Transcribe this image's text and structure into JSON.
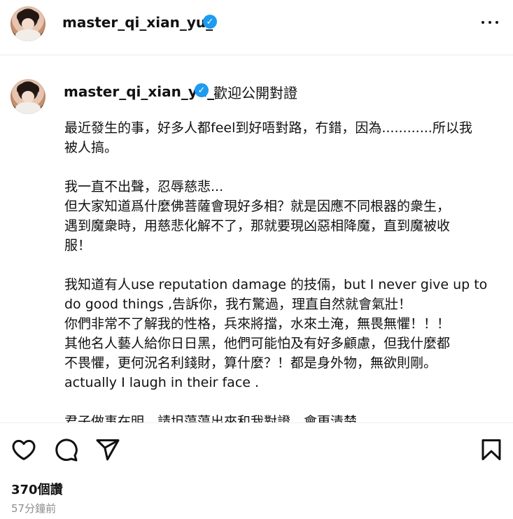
{
  "header": {
    "username": "master_qi_xian_yu_",
    "verified_symbol": "✓",
    "more_icon": "ellipsis"
  },
  "post": {
    "username": "master_qi_xian_yu_",
    "verified_symbol": "✓",
    "lead_text": "歡迎公開對證",
    "caption": "最近發生的事，好多人都feel到好唔對路，冇錯，因為............所以我\n被人搞。\n\n我一直不出聲，忍辱慈悲...\n但大家知道爲什麼佛菩薩會現好多相？就是因應不同根器的衆生，\n遇到魔衆時，用慈悲化解不了，那就要現凶惡相降魔，直到魔被收\n服！\n\n我知道有人use reputation damage 的技倆，but I never give up to\ndo good things ,告訴你，我冇驚過，理直自然就會氣壯！\n你們非常不了解我的性格，兵來將擋，水來土淹，無畏無懼！！！\n其他名人藝人給你日日黑，他們可能怕及有好多顧慮，但我什麼都\n不畏懼，更何況名利錢財，算什麼？！都是身外物，無欲則剛。\nactually I laugh in their face .\n\n君子做事在明，請坦蕩蕩出來和我對證，會更清楚。"
  },
  "actions": {
    "icons": [
      "heart-icon",
      "comment-icon",
      "share-icon",
      "save-icon"
    ]
  },
  "likes": "370個讚",
  "timestamp": "57分鐘前",
  "colors": {
    "verified": "#1d9bf0",
    "text": "#111111",
    "muted": "#8e8e8e",
    "divider": "#ececec"
  }
}
